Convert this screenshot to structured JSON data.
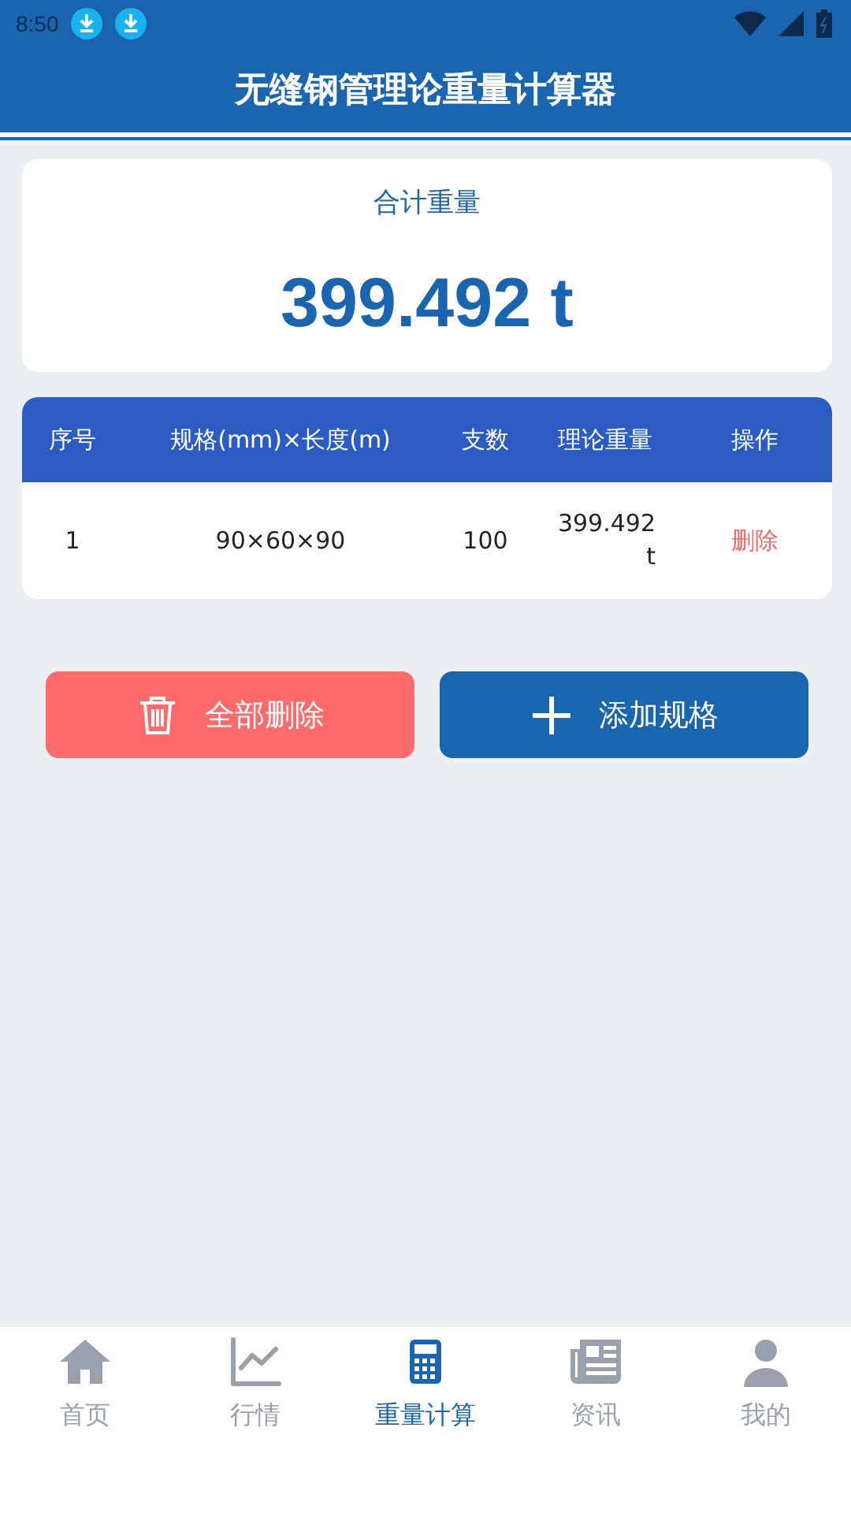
{
  "status_bar": {
    "time": "8:50"
  },
  "app_bar": {
    "title": "无缝钢管理论重量计算器"
  },
  "total": {
    "label": "合计重量",
    "value": "399.492 t"
  },
  "table": {
    "columns": [
      "序号",
      "规格(mm)×长度(m)",
      "支数",
      "理论重量",
      "操作"
    ],
    "rows": [
      {
        "index": "1",
        "spec": "90×60×90",
        "count": "100",
        "weight": "399.492 t",
        "action": "删除"
      }
    ]
  },
  "buttons": [
    {
      "kind": "delete",
      "label": "全部删除"
    },
    {
      "kind": "add",
      "label": "添加规格"
    }
  ],
  "bottom_nav": [
    {
      "kind": "home",
      "label": "首页",
      "selected": false
    },
    {
      "kind": "chart",
      "label": "行情",
      "selected": false
    },
    {
      "kind": "calculator",
      "label": "重量计算",
      "selected": true
    },
    {
      "kind": "news",
      "label": "资讯",
      "selected": false
    },
    {
      "kind": "user",
      "label": "我的",
      "selected": false
    }
  ]
}
